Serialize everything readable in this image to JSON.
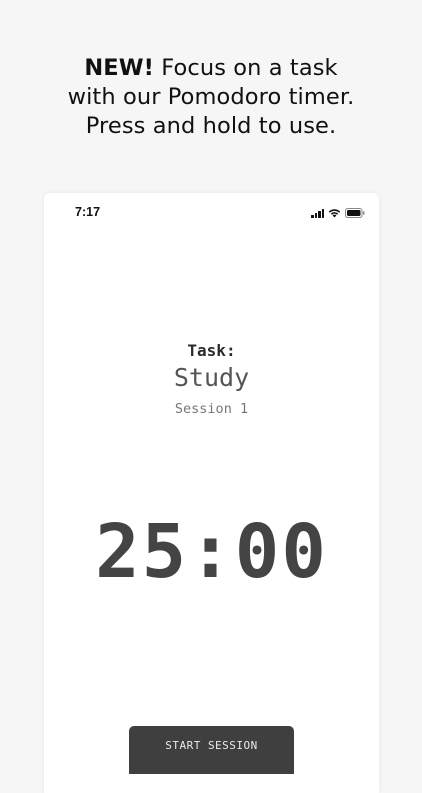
{
  "headline": {
    "bold": "NEW!",
    "line1_rest": " Focus on a task",
    "line2": "with our Pomodoro timer.",
    "line3": "Press and hold to use."
  },
  "status_bar": {
    "time": "7:17",
    "icons": [
      "signal-icon",
      "wifi-icon",
      "battery-icon"
    ]
  },
  "task": {
    "label": "Task:",
    "name": "Study",
    "session": "Session 1"
  },
  "timer": {
    "display": "25:00"
  },
  "actions": {
    "start_label": "START SESSION"
  },
  "colors": {
    "background": "#f6f6f6",
    "screen": "#ffffff",
    "timer_text": "#444444",
    "button": "#3f3f3f"
  }
}
